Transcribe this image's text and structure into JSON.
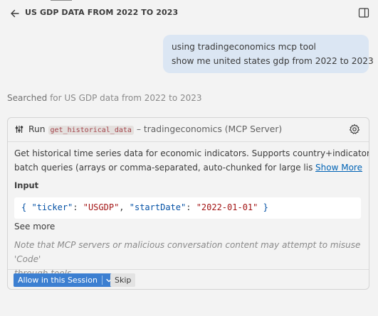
{
  "header": {
    "title": "US GDP DATA FROM 2022 TO 2023",
    "back_icon": "arrow-left-icon",
    "panel_icon": "split-panel-icon"
  },
  "user_message": {
    "line1": "using tradingeconomics mcp tool",
    "line2": "show me united states gdp from 2022 to 2023"
  },
  "search_status": {
    "verb": "Searched",
    "detail": "for US GDP data from 2022 to 2023"
  },
  "tool_card": {
    "run_label": "Run",
    "tool_name": "get_historical_data",
    "server": "– tradingeconomics (MCP Server)",
    "description_line1": "Get historical time series data for economic indicators. Supports country+indicator",
    "description_line2": "batch queries (arrays or comma-separated, auto-chunked for large lists)",
    "show_more": "Show More",
    "input_label": "Input",
    "input": {
      "open_brace": "{",
      "key1": "\"ticker\"",
      "value1": "\"USGDP\"",
      "key2": "\"startDate\"",
      "value2": "\"2022-01-01\"",
      "close_brace": "}"
    },
    "see_more": "See more",
    "note_line1": "Note that MCP servers or malicious conversation content may attempt to misuse 'Code'",
    "note_line2": "through tools.",
    "allow_button": "Allow in this Session",
    "skip_button": "Skip"
  },
  "colors": {
    "background": "#f3f3f3",
    "bubble": "#dbe6f3",
    "primary_button": "#3c7fd1",
    "link": "#0063b5"
  }
}
